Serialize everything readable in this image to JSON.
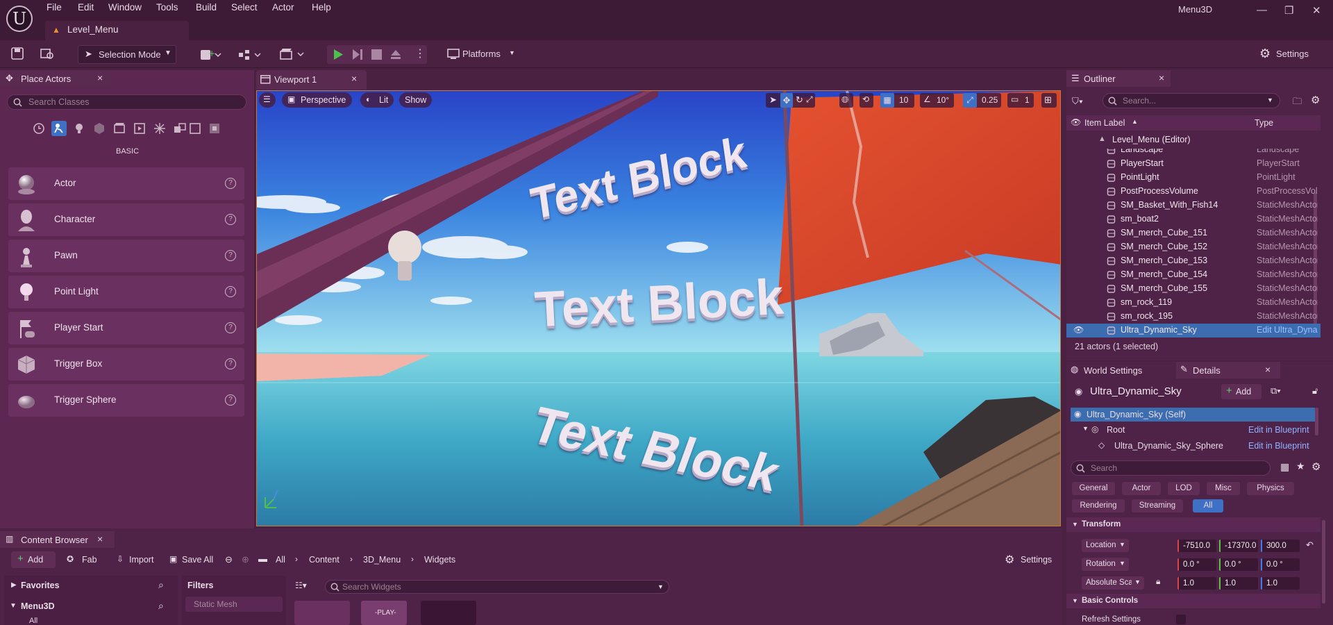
{
  "menu": {
    "items": [
      "File",
      "Edit",
      "Window",
      "Tools",
      "Build",
      "Select",
      "Actor",
      "Help"
    ]
  },
  "window": {
    "project_name": "Menu3D",
    "level_tab": "Level_Menu"
  },
  "toolbar": {
    "selection_mode": "Selection Mode",
    "platforms": "Platforms",
    "settings": "Settings"
  },
  "place_actors": {
    "tab_label": "Place Actors",
    "search_placeholder": "Search Classes",
    "category_label": "BASIC",
    "items": [
      "Actor",
      "Character",
      "Pawn",
      "Point Light",
      "Player Start",
      "Trigger Box",
      "Trigger Sphere"
    ]
  },
  "viewport": {
    "tab_label": "Viewport 1",
    "perspective": "Perspective",
    "lit": "Lit",
    "show": "Show",
    "grid_snap": "10",
    "rot_snap": "10°",
    "scale_snap": "0.25",
    "camera_speed": "1",
    "text_blocks": [
      "Text Block",
      "Text Block",
      "Text Block"
    ]
  },
  "outliner": {
    "tab_label": "Outliner",
    "search_placeholder": "Search...",
    "col_label": "Item Label",
    "col_type": "Type",
    "root": "Level_Menu (Editor)",
    "rows": [
      {
        "name": "Landscape",
        "type": "Landscape"
      },
      {
        "name": "PlayerStart",
        "type": "PlayerStart"
      },
      {
        "name": "PointLight",
        "type": "PointLight"
      },
      {
        "name": "PostProcessVolume",
        "type": "PostProcessVolume"
      },
      {
        "name": "SM_Basket_With_Fish14",
        "type": "StaticMeshActor"
      },
      {
        "name": "sm_boat2",
        "type": "StaticMeshActor"
      },
      {
        "name": "SM_merch_Cube_151",
        "type": "StaticMeshActor"
      },
      {
        "name": "SM_merch_Cube_152",
        "type": "StaticMeshActor"
      },
      {
        "name": "SM_merch_Cube_153",
        "type": "StaticMeshActor"
      },
      {
        "name": "SM_merch_Cube_154",
        "type": "StaticMeshActor"
      },
      {
        "name": "SM_merch_Cube_155",
        "type": "StaticMeshActor"
      },
      {
        "name": "sm_rock_119",
        "type": "StaticMeshActor"
      },
      {
        "name": "sm_rock_195",
        "type": "StaticMeshActor"
      },
      {
        "name": "Ultra_Dynamic_Sky",
        "type": "Edit Ultra_Dynamic_Sky"
      }
    ],
    "status": "21 actors (1 selected)"
  },
  "details": {
    "world_settings_tab": "World Settings",
    "details_tab": "Details",
    "actor_name": "Ultra_Dynamic_Sky",
    "add_label": "Add",
    "component_self": "Ultra_Dynamic_Sky (Self)",
    "component_root": "Root",
    "component_sphere": "Ultra_Dynamic_Sky_Sphere",
    "edit_in_blueprint": "Edit in Blueprint",
    "search_placeholder": "Search",
    "filters": [
      "General",
      "Actor",
      "LOD",
      "Misc",
      "Physics",
      "Rendering",
      "Streaming",
      "All"
    ],
    "transform_header": "Transform",
    "location_label": "Location",
    "rotation_label": "Rotation",
    "scale_label": "Absolute Sca",
    "location": [
      "-7510.0",
      "-17370.0",
      "300.0"
    ],
    "rotation": [
      "0.0 °",
      "0.0 °",
      "0.0 °"
    ],
    "scale": [
      "1.0",
      "1.0",
      "1.0"
    ],
    "basic_controls_header": "Basic Controls",
    "refresh_settings": "Refresh Settings"
  },
  "content_browser": {
    "tab_label": "Content Browser",
    "add": "Add",
    "fab": "Fab",
    "import": "Import",
    "save_all": "Save All",
    "breadcrumb": [
      "All",
      "Content",
      "3D_Menu",
      "Widgets"
    ],
    "settings": "Settings",
    "favorites": "Favorites",
    "project": "Menu3D",
    "all": "All",
    "filters": "Filters",
    "static_mesh": "Static Mesh",
    "search_placeholder": "Search Widgets",
    "asset_label": "-PLAY-"
  },
  "colors": {
    "accent": "#3f73c8",
    "bg": "#4a2141",
    "selection": "#3b6db0"
  }
}
